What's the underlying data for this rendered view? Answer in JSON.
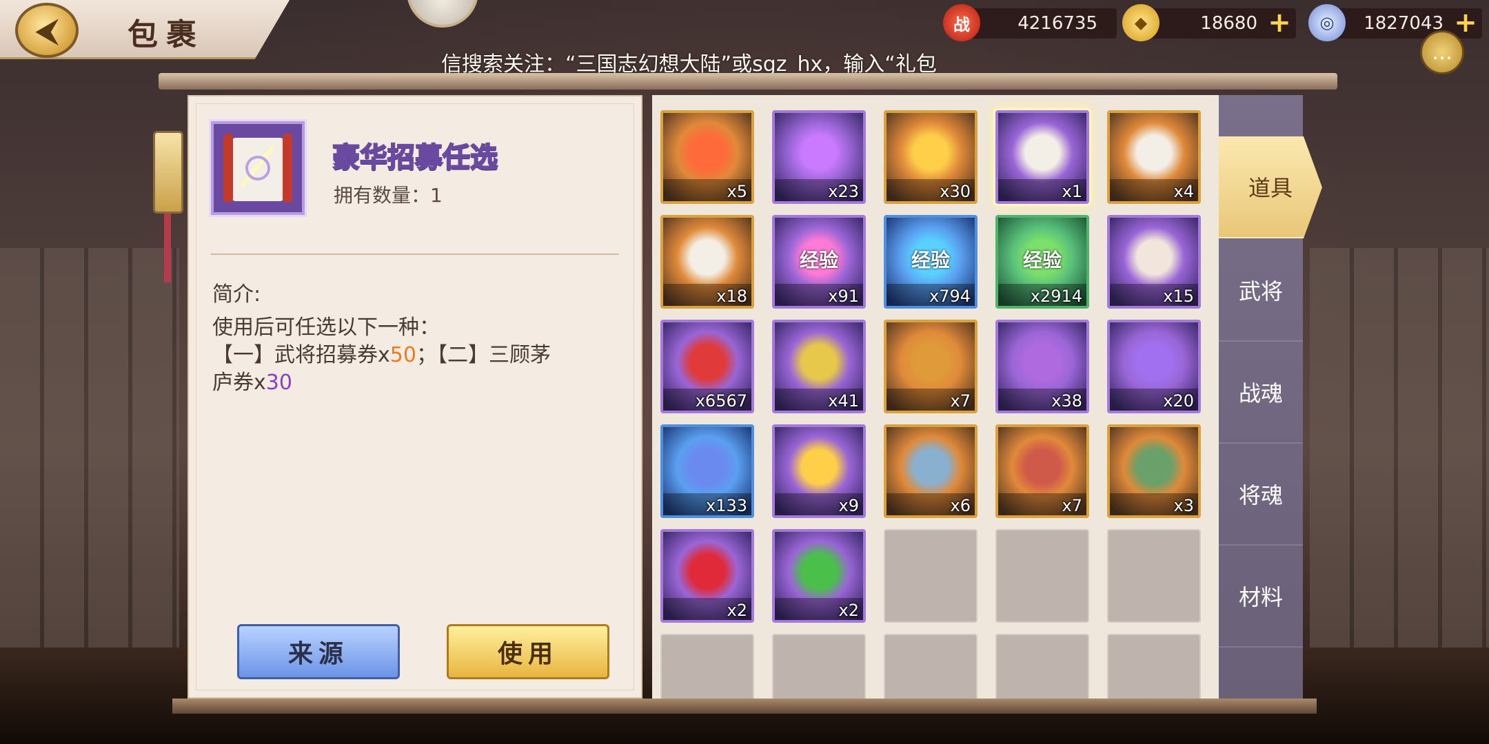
{
  "header": {
    "title": "包裹",
    "back_label": "⮜"
  },
  "currencies": {
    "power": {
      "icon": "战",
      "value": "4216735"
    },
    "gold": {
      "icon": "◆",
      "value": "18680"
    },
    "coin": {
      "icon": "◎",
      "value": "1827043"
    }
  },
  "marquee": {
    "text": "信搜索关注：“三国志幻想大陆”或sgz_hx，输入“礼包"
  },
  "detail": {
    "name": "豪华招募任选",
    "count_label": "拥有数量：",
    "count_value": "1",
    "desc_title": "简介:",
    "desc_line1": "使用后可任选以下一种：",
    "desc_line2_a": "【一】武将招募券x",
    "desc_line2_b": "50",
    "desc_line2_c": "；【二】三顾茅",
    "desc_line3_a": "庐券x",
    "desc_line3_b": "30",
    "source_button": "来源",
    "use_button": "使用"
  },
  "items": [
    {
      "qty": "x5",
      "rarity": "gold",
      "icon": "fire-token-icon"
    },
    {
      "qty": "x23",
      "rarity": "purple",
      "icon": "purple-flame-icon"
    },
    {
      "qty": "x30",
      "rarity": "gold",
      "icon": "purple-gem-icon"
    },
    {
      "qty": "x1",
      "rarity": "purple",
      "icon": "recruit-scroll-icon"
    },
    {
      "qty": "x4",
      "rarity": "gold",
      "icon": "map-scroll-icon"
    },
    {
      "qty": "x18",
      "rarity": "gold",
      "icon": "hero-scroll-icon"
    },
    {
      "qty": "x91",
      "rarity": "purple",
      "icon": "exp-orb-purple-icon",
      "label": "经验"
    },
    {
      "qty": "x794",
      "rarity": "blue",
      "icon": "exp-orb-blue-icon",
      "label": "经验"
    },
    {
      "qty": "x2914",
      "rarity": "green",
      "icon": "exp-orb-green-icon",
      "label": "经验"
    },
    {
      "qty": "x15",
      "rarity": "purple",
      "icon": "conch-icon"
    },
    {
      "qty": "x6567",
      "rarity": "purple",
      "icon": "red-crystal-icon"
    },
    {
      "qty": "x41",
      "rarity": "purple",
      "icon": "gold-bars-icon"
    },
    {
      "qty": "x7",
      "rarity": "gold",
      "icon": "emperor-token-icon"
    },
    {
      "qty": "x38",
      "rarity": "purple",
      "icon": "purple-shard-icon"
    },
    {
      "qty": "x20",
      "rarity": "purple",
      "icon": "purple-rune-stone-icon"
    },
    {
      "qty": "x133",
      "rarity": "blue",
      "icon": "blue-rune-stone-icon"
    },
    {
      "qty": "x9",
      "rarity": "purple",
      "icon": "gold-ticket-icon"
    },
    {
      "qty": "x6",
      "rarity": "gold",
      "icon": "blue-blueprint-icon"
    },
    {
      "qty": "x7",
      "rarity": "gold",
      "icon": "red-blueprint-icon"
    },
    {
      "qty": "x3",
      "rarity": "gold",
      "icon": "green-blueprint-icon"
    },
    {
      "qty": "x2",
      "rarity": "purple",
      "icon": "roses-icon"
    },
    {
      "qty": "x2",
      "rarity": "purple",
      "icon": "clover-icon"
    }
  ],
  "tabs": [
    {
      "label": "道具",
      "active": true
    },
    {
      "label": "武将",
      "active": false
    },
    {
      "label": "战魂",
      "active": false
    },
    {
      "label": "将魂",
      "active": false
    },
    {
      "label": "材料",
      "active": false
    }
  ],
  "colors": {
    "gold_border": "#d9a23c",
    "purple_border": "#a579d9",
    "blue_border": "#4f8fe0",
    "green_border": "#4fb46a",
    "highlight_orange": "#f07a1a",
    "highlight_purple": "#8a3fc8"
  }
}
